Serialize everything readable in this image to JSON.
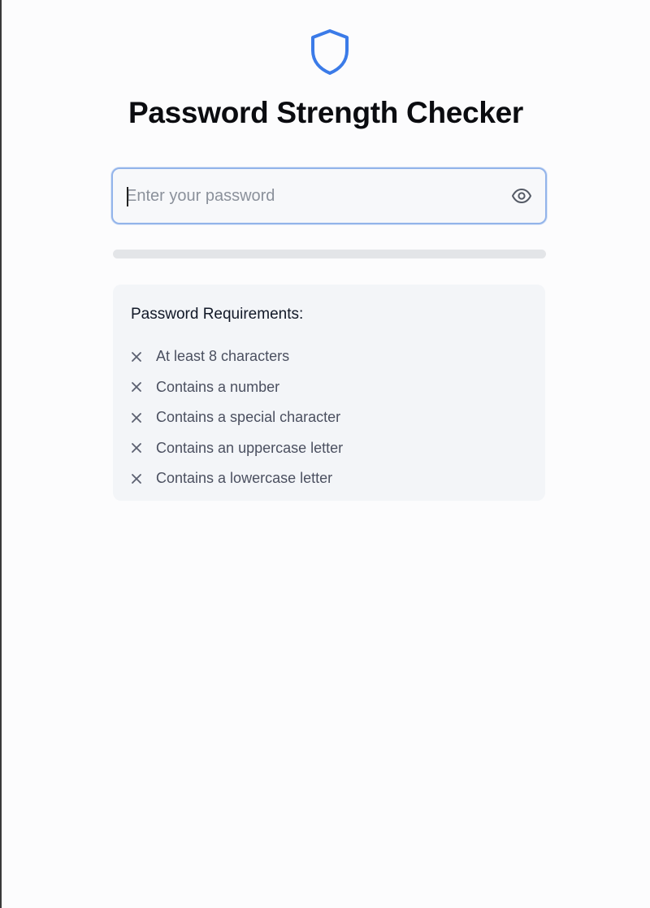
{
  "header": {
    "icon": "shield-icon",
    "title": "Password Strength Checker",
    "accent_color": "#3b7be8"
  },
  "password_field": {
    "value": "",
    "placeholder": "Enter your password",
    "toggle_icon": "eye-icon"
  },
  "strength_meter": {
    "fraction": 0
  },
  "requirements": {
    "heading": "Password Requirements:",
    "status_icon": "x-icon",
    "items": [
      {
        "label": "At least 8 characters",
        "met": false
      },
      {
        "label": "Contains a number",
        "met": false
      },
      {
        "label": "Contains a special character",
        "met": false
      },
      {
        "label": "Contains an uppercase letter",
        "met": false
      },
      {
        "label": "Contains a lowercase letter",
        "met": false
      }
    ]
  }
}
